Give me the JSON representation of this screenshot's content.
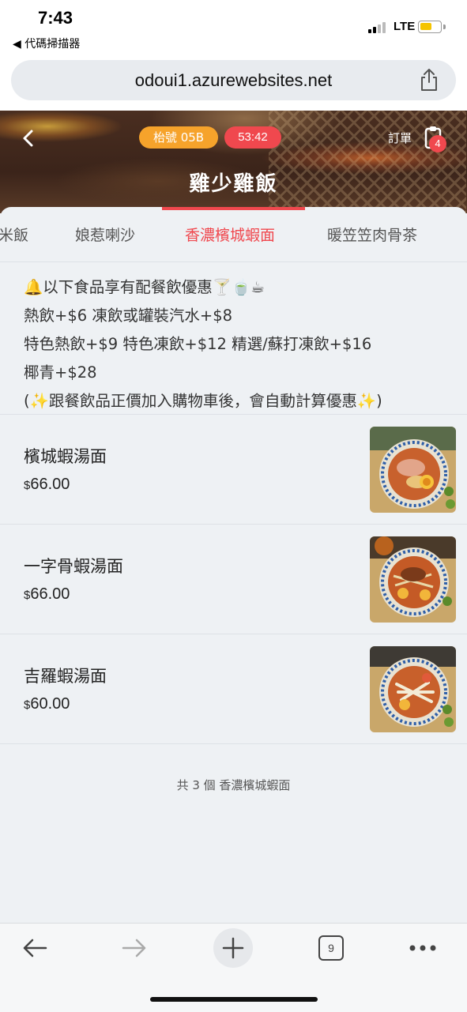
{
  "status_bar": {
    "time": "7:43",
    "back_app": "◀ 代碼掃描器",
    "network": "LTE",
    "battery_color": "#f5c400"
  },
  "browser": {
    "url": "odoui1.azurewebsites.net",
    "share_icon": "share-icon",
    "tab_count": "9"
  },
  "header": {
    "table_label": "枱號 05B",
    "timer": "53:42",
    "order_label": "訂單",
    "order_count": "4",
    "store_title": "雞少雞飯",
    "accent_color": "#f0484e",
    "table_badge_color": "#f6a32b"
  },
  "category_tabs": [
    {
      "label": "米飯",
      "active": false
    },
    {
      "label": "娘惹喇沙",
      "active": false
    },
    {
      "label": "香濃檳城蝦面",
      "active": true
    },
    {
      "label": "暖笠笠肉骨茶",
      "active": false
    }
  ],
  "promo": {
    "line1": "🔔以下食品享有配餐飲優惠🍸🍵☕",
    "line2": "熱飲+$6 凍飲或罐裝汽水+$8",
    "line3": "特色熱飲+$9 特色凍飲+$12 精選/蘇打凍飲+$16",
    "line4": "椰青+$28",
    "line5": "(✨跟餐飲品正價加入購物車後，會自動計算優惠✨)"
  },
  "menu_items": [
    {
      "name": "檳城蝦湯面",
      "currency": "$",
      "price": "66.00"
    },
    {
      "name": "一字骨蝦湯面",
      "currency": "$",
      "price": "66.00"
    },
    {
      "name": "吉羅蝦湯面",
      "currency": "$",
      "price": "60.00"
    }
  ],
  "footer_count": "共 3 個 香濃檳城蝦面"
}
